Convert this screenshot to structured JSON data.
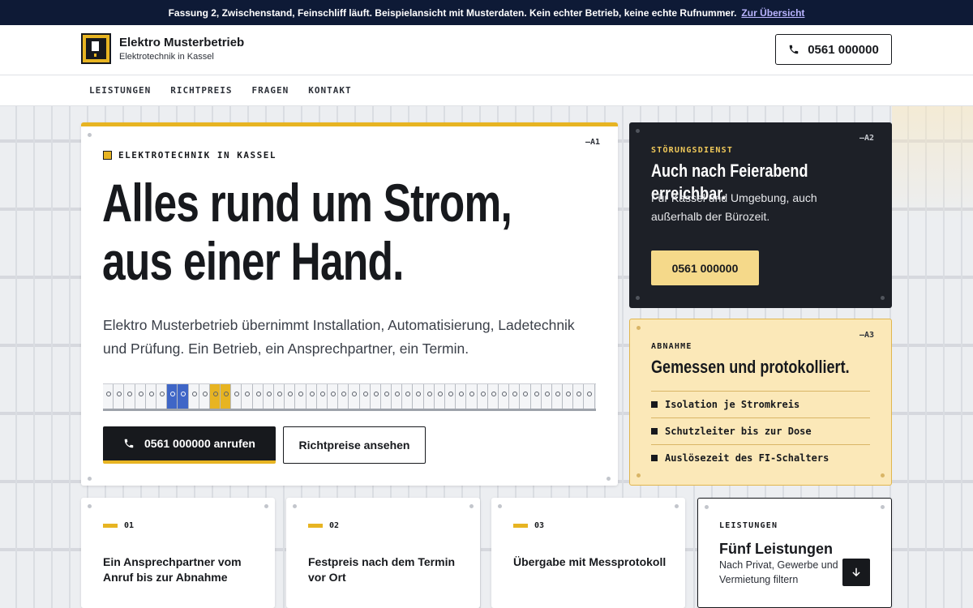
{
  "notice": {
    "text": "Fassung 2, Zwischenstand, Feinschliff läuft. Beispielansicht mit Musterdaten. Kein echter Betrieb, keine echte Rufnummer.",
    "link": "Zur Übersicht"
  },
  "header": {
    "brand_name": "Elektro Musterbetrieb",
    "brand_sub": "Elektrotechnik in Kassel",
    "phone": "0561 000000"
  },
  "nav": [
    "LEISTUNGEN",
    "RICHTPREIS",
    "FRAGEN",
    "KONTAKT"
  ],
  "hero": {
    "tag": "—A1",
    "kicker": "ELEKTROTECHNIK IN KASSEL",
    "title_line1": "Alles rund um Strom,",
    "title_line2": "aus einer Hand.",
    "lead": "Elektro Musterbetrieb übernimmt Installation, Automatisierung, Ladetechnik und Prüfung. Ein Betrieb, ein Ansprechpartner, ein Termin.",
    "call_button": "0561 000000 anrufen",
    "prices_button": "Richtpreise ansehen"
  },
  "service_card": {
    "tag": "—A2",
    "kicker": "STÖRUNGSDIENST",
    "title": "Auch nach Feierabend erreichbar.",
    "text": "Für Kassel und Umgebung, auch außerhalb der Bürozeit.",
    "button": "0561 000000"
  },
  "acceptance_card": {
    "tag": "—A3",
    "kicker": "ABNAHME",
    "title": "Gemessen und protokolliert.",
    "items": [
      "Isolation je Stromkreis",
      "Schutzleiter bis zur Dose",
      "Auslösezeit des FI-Schalters"
    ]
  },
  "features": [
    {
      "num": "01",
      "text": "Ein Ansprechpartner vom Anruf bis zur Abnahme"
    },
    {
      "num": "02",
      "text": "Festpreis nach dem Termin vor Ort"
    },
    {
      "num": "03",
      "text": "Übergabe mit Messprotokoll"
    }
  ],
  "services_teaser": {
    "kicker": "LEISTUNGEN",
    "title": "Fünf Leistungen",
    "sub": "Nach Privat, Gewerbe und Vermietung filtern"
  },
  "icons": {
    "phone": "phone-icon",
    "arrow": "arrow-down-icon",
    "logo": "fuse-box-logo-icon"
  },
  "colors": {
    "accent": "#e7b422",
    "dark": "#17191d",
    "navy": "#0e1a36",
    "soft_yellow": "#fbe8b8"
  }
}
